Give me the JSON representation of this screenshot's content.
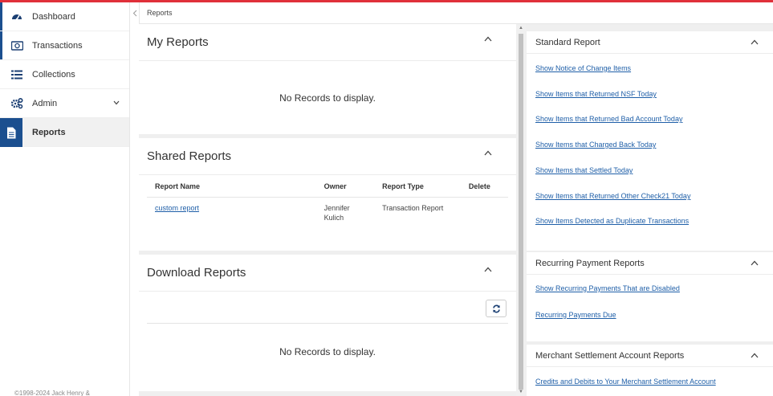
{
  "nav": {
    "items": [
      {
        "label": "Dashboard",
        "icon": "dashboard-icon"
      },
      {
        "label": "Transactions",
        "icon": "transactions-icon"
      },
      {
        "label": "Collections",
        "icon": "collections-icon"
      },
      {
        "label": "Admin",
        "icon": "admin-gears-icon"
      },
      {
        "label": "Reports",
        "icon": "reports-document-icon"
      }
    ],
    "copyright": "©1998-2024 Jack Henry &"
  },
  "breadcrumb": "Reports",
  "my_reports": {
    "title": "My Reports",
    "empty": "No Records to display."
  },
  "shared_reports": {
    "title": "Shared Reports",
    "columns": [
      "Report Name",
      "Owner",
      "Report Type",
      "Delete"
    ],
    "rows": [
      {
        "name": "custom report",
        "owner_first": "Jennifer",
        "owner_last": "Kulich",
        "type": "Transaction Report"
      }
    ]
  },
  "download_reports": {
    "title": "Download Reports",
    "empty": "No Records to display."
  },
  "standard_report": {
    "title": "Standard Report",
    "links": [
      "Show Notice of Change Items",
      "Show Items that Returned NSF Today",
      "Show Items that Returned Bad Account Today",
      "Show Items that Charged Back Today",
      "Show Items that Settled Today",
      "Show Items that Returned Other Check21 Today",
      "Show Items Detected as Duplicate Transactions"
    ]
  },
  "recurring_reports": {
    "title": "Recurring Payment Reports",
    "links": [
      "Show Recurring Payments That are Disabled",
      "Recurring Payments Due"
    ]
  },
  "merchant_reports": {
    "title": "Merchant Settlement Account Reports",
    "links": [
      "Credits and Debits to Your Merchant Settlement Account"
    ]
  },
  "colors": {
    "accent": "#1b4f8f",
    "top_bar": "#e0303a",
    "link": "#1f5fa8"
  }
}
